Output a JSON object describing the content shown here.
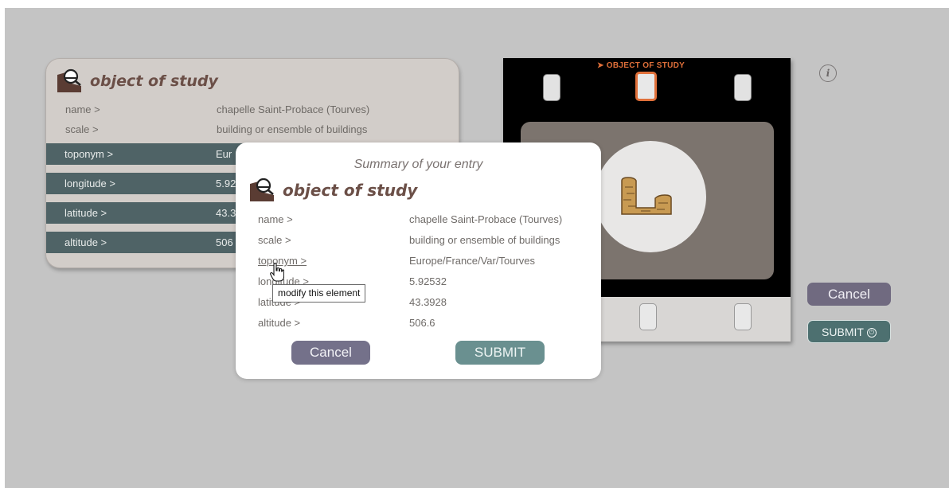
{
  "card": {
    "title": "object of study",
    "rows": [
      {
        "label": "name >",
        "value": "chapelle Saint-Probace (Tourves)"
      },
      {
        "label": "scale >",
        "value": "building or ensemble of buildings"
      },
      {
        "label": "toponym >",
        "value": "Eur"
      },
      {
        "label": "longitude >",
        "value": "5.92"
      },
      {
        "label": "latitude >",
        "value": "43.3"
      },
      {
        "label": "altitude >",
        "value": "506"
      }
    ]
  },
  "film": {
    "label": "➤ OBJECT OF STUDY",
    "icon": "tower-wall-icon"
  },
  "buttons": {
    "cancel": "Cancel",
    "submit": "SUBMIT"
  },
  "modal": {
    "subtitle": "Summary of your entry",
    "title": "object of study",
    "rows": [
      {
        "label": "name >",
        "value": "chapelle Saint-Probace (Tourves)"
      },
      {
        "label": "scale >",
        "value": "building or ensemble of buildings"
      },
      {
        "label": "toponym >",
        "value": "Europe/France/Var/Tourves"
      },
      {
        "label": "longitude >",
        "value": "5.92532"
      },
      {
        "label": "latitude >",
        "value": "43.3928"
      },
      {
        "label": "altitude >",
        "value": "506.6"
      }
    ],
    "cancel": "Cancel",
    "submit": "SUBMIT",
    "tooltip": "modify this element"
  },
  "colors": {
    "accent_orange": "#e0703a",
    "row_dark": "#4f6366",
    "title_brown": "#6b4f47"
  }
}
